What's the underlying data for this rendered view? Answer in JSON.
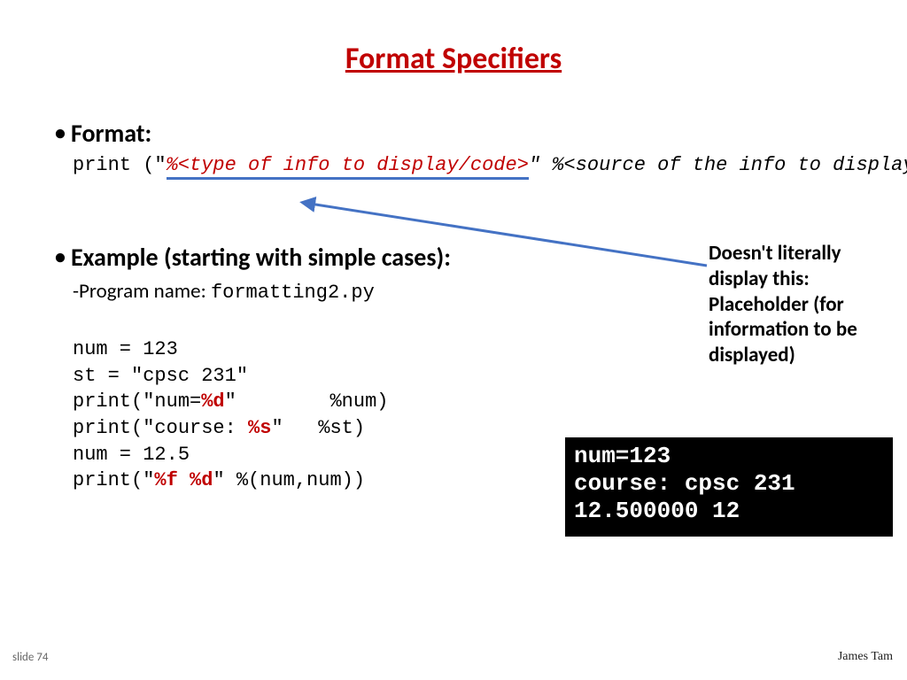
{
  "title": "Format Specifiers",
  "heading_format": "Format:",
  "format_code": {
    "pre": "print (\"",
    "placeholder": "%<type of info to display/code>",
    "mid": "\" %<",
    "src": "source of the info to display",
    "post": ">)"
  },
  "heading_example": "Example (starting with simple cases):",
  "subline_prefix": "-Program name: ",
  "subline_file": "formatting2.py",
  "code": {
    "l1": "num = 123",
    "l2": "st = \"cpsc 231\"",
    "l3a": "print(\"num=",
    "l3b": "%d",
    "l3c": "\"        %num)",
    "l4a": "print(\"course: ",
    "l4b": "%s",
    "l4c": "\"   %st)",
    "l5": "num = 12.5",
    "l6a": "print(\"",
    "l6b": "%f %d",
    "l6c": "\" %(num,num))"
  },
  "annotation": "Doesn't literally display this: Placeholder (for information to be displayed)",
  "terminal": {
    "l1": "num=123",
    "l2": "course: cpsc 231",
    "l3": "12.500000 12"
  },
  "slide_num": "slide 74",
  "author": "James Tam"
}
